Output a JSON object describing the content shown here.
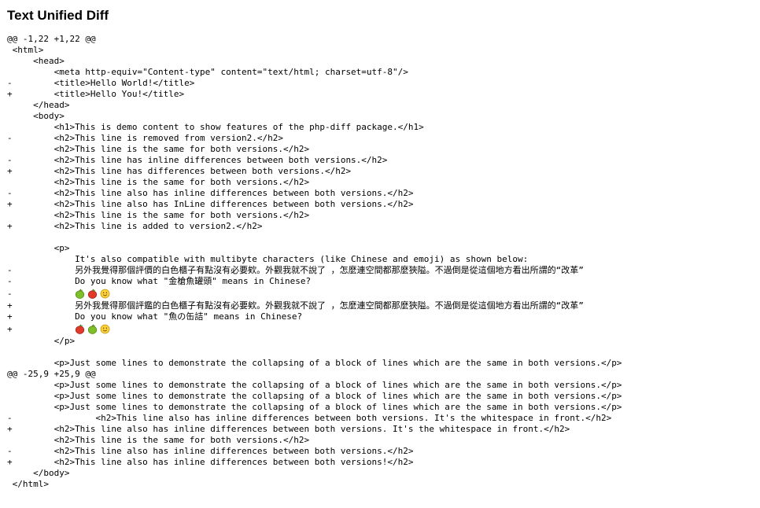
{
  "title": "Text Unified Diff",
  "lines": [
    {
      "sign": "",
      "text": "@@ -1,22 +1,22 @@"
    },
    {
      "sign": " ",
      "text": "<html>"
    },
    {
      "sign": " ",
      "text": "    <head>"
    },
    {
      "sign": " ",
      "text": "        <meta http-equiv=\"Content-type\" content=\"text/html; charset=utf-8\"/>"
    },
    {
      "sign": "-",
      "text": "        <title>Hello World!</title>"
    },
    {
      "sign": "+",
      "text": "        <title>Hello You!</title>"
    },
    {
      "sign": " ",
      "text": "    </head>"
    },
    {
      "sign": " ",
      "text": "    <body>"
    },
    {
      "sign": " ",
      "text": "        <h1>This is demo content to show features of the php-diff package.</h1>"
    },
    {
      "sign": "-",
      "text": "        <h2>This line is removed from version2.</h2>"
    },
    {
      "sign": " ",
      "text": "        <h2>This line is the same for both versions.</h2>"
    },
    {
      "sign": "-",
      "text": "        <h2>This line has inline differences between both versions.</h2>"
    },
    {
      "sign": "+",
      "text": "        <h2>This line has differences between both versions.</h2>"
    },
    {
      "sign": " ",
      "text": "        <h2>This line is the same for both versions.</h2>"
    },
    {
      "sign": "-",
      "text": "        <h2>This line also has inline differences between both versions.</h2>"
    },
    {
      "sign": "+",
      "text": "        <h2>This line also has InLine differences between both versions.</h2>"
    },
    {
      "sign": " ",
      "text": "        <h2>This line is the same for both versions.</h2>"
    },
    {
      "sign": "+",
      "text": "        <h2>This line is added to version2.</h2>"
    },
    {
      "sign": " ",
      "text": ""
    },
    {
      "sign": " ",
      "text": "        <p>"
    },
    {
      "sign": " ",
      "text": "            It's also compatible with multibyte characters (like Chinese and emoji) as shown below:"
    },
    {
      "sign": "-",
      "text": "            另外我覺得那個評價的白色櫃子有點沒有必要欸。外觀我就不說了 ，怎麼連空間都那麼狹隘。不過倒是從這個地方看出所謂的“改革”"
    },
    {
      "sign": "-",
      "text": "            Do you know what \"金槍魚罐頭\" means in Chinese?"
    },
    {
      "sign": "-",
      "text": "            ",
      "emoji": [
        "green-apple-icon",
        "red-apple-icon",
        "smiley-icon"
      ]
    },
    {
      "sign": "+",
      "text": "            另外我覺得那個評鑑的白色櫃子有點沒有必要欸。外觀我就不說了 ，怎麼連空間都那麼狹隘。不過倒是從這個地方看出所謂的“改革”"
    },
    {
      "sign": "+",
      "text": "            Do you know what \"魚の缶詰\" means in Chinese?"
    },
    {
      "sign": "+",
      "text": "            ",
      "emoji": [
        "red-apple-icon",
        "green-apple-icon",
        "smiley-icon"
      ]
    },
    {
      "sign": " ",
      "text": "        </p>"
    },
    {
      "sign": " ",
      "text": ""
    },
    {
      "sign": " ",
      "text": "        <p>Just some lines to demonstrate the collapsing of a block of lines which are the same in both versions.</p>"
    },
    {
      "sign": "",
      "text": "@@ -25,9 +25,9 @@"
    },
    {
      "sign": " ",
      "text": "        <p>Just some lines to demonstrate the collapsing of a block of lines which are the same in both versions.</p>"
    },
    {
      "sign": " ",
      "text": "        <p>Just some lines to demonstrate the collapsing of a block of lines which are the same in both versions.</p>"
    },
    {
      "sign": " ",
      "text": "        <p>Just some lines to demonstrate the collapsing of a block of lines which are the same in both versions.</p>"
    },
    {
      "sign": "-",
      "text": "                <h2>This line also has inline differences between both versions. It's the whitespace in front.</h2>"
    },
    {
      "sign": "+",
      "text": "        <h2>This line also has inline differences between both versions. It's the whitespace in front.</h2>"
    },
    {
      "sign": " ",
      "text": "        <h2>This line is the same for both versions.</h2>"
    },
    {
      "sign": "-",
      "text": "        <h2>This line also has inline differences between both versions.</h2>"
    },
    {
      "sign": "+",
      "text": "        <h2>This line also has inline differences between both versions!</h2>"
    },
    {
      "sign": " ",
      "text": "    </body>"
    },
    {
      "sign": " ",
      "text": "</html>"
    }
  ]
}
